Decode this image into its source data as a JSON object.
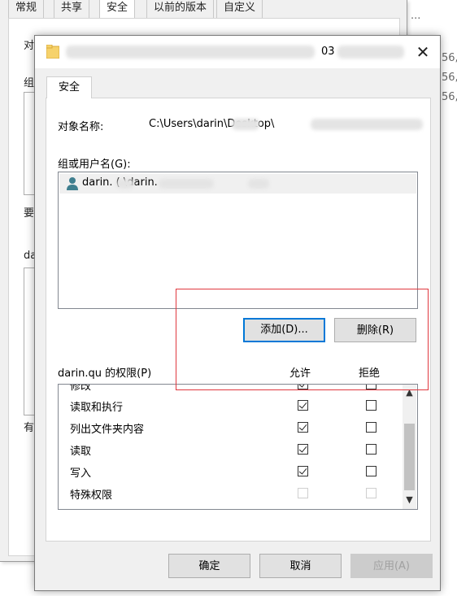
{
  "background_dialog": {
    "tabs": [
      "常规",
      "共享",
      "安全",
      "以前的版本",
      "自定义"
    ],
    "fragments": {
      "object_prefix": "对",
      "group_prefix": "组",
      "require_prefix": "要",
      "user_prefix": "da",
      "have_prefix": "有"
    }
  },
  "side_fragments": [
    "56,",
    "56,",
    "56,",
    "..."
  ],
  "dialog": {
    "title_suffix": "03",
    "close_glyph": "✕",
    "tab_label": "安全",
    "object_name_label": "对象名称:",
    "object_name_value": "C:\\Users\\darin\\Desktop\\",
    "groups_label": "组或用户名(G):",
    "users": [
      {
        "name": "darin.      (            \\darin.",
        "icon": "user-icon",
        "selected": true
      }
    ],
    "buttons": {
      "add": "添加(D)...",
      "remove": "删除(R)",
      "ok": "确定",
      "cancel": "取消",
      "apply": "应用(A)"
    },
    "permissions_label": "darin.qu 的权限(P)",
    "allow_header": "允许",
    "deny_header": "拒绝",
    "permissions": [
      {
        "name": "修改",
        "allow": true,
        "deny": false,
        "disabled": false
      },
      {
        "name": "读取和执行",
        "allow": true,
        "deny": false,
        "disabled": false
      },
      {
        "name": "列出文件夹内容",
        "allow": true,
        "deny": false,
        "disabled": false
      },
      {
        "name": "读取",
        "allow": true,
        "deny": false,
        "disabled": false
      },
      {
        "name": "写入",
        "allow": true,
        "deny": false,
        "disabled": false
      },
      {
        "name": "特殊权限",
        "allow": false,
        "deny": false,
        "disabled": true
      }
    ],
    "scroll_up_glyph": "▲",
    "scroll_down_glyph": "▼"
  },
  "colors": {
    "annotation": "#e0383f",
    "primary_focus": "#0078d7"
  }
}
